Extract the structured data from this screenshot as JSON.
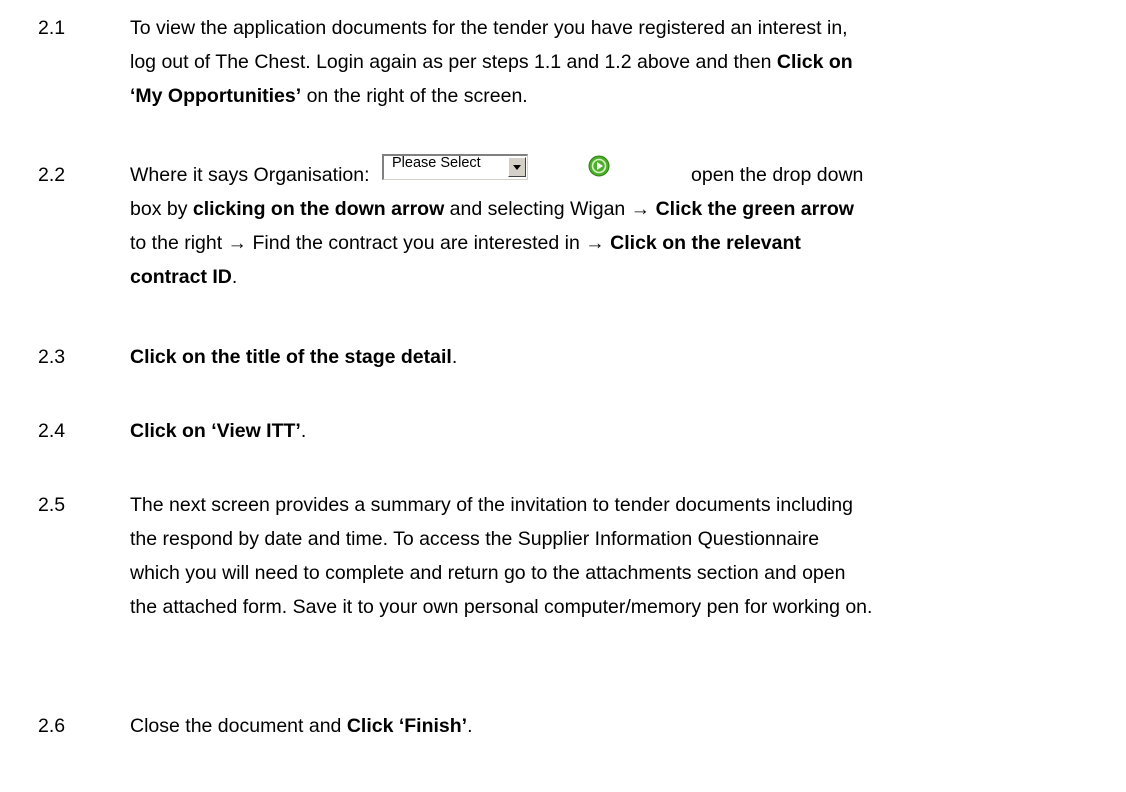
{
  "steps": {
    "s21": {
      "num": "2.1",
      "l1": "To view the application documents for the tender you have registered an interest in,",
      "l2a": "log out of The Chest. Login again as per steps 1.1 and 1.2 above and then ",
      "l2b": "Click on",
      "l3a": "‘My Opportunities’",
      "l3b": " on the right of the screen."
    },
    "s22": {
      "num": "2.2",
      "l1a": "Where it says Organisation:",
      "select_value": "Please Select",
      "l1b": "open the drop down",
      "l2a": "box by ",
      "l2b": "clicking on the down arrow",
      "l2c": " and selecting Wigan → ",
      "l2d": "Click the green arrow",
      "l3a": "to the right → Find the contract you are interested in → ",
      "l3b": "Click on the relevant",
      "l4a": "contract ID",
      "l4b": "."
    },
    "s23": {
      "num": "2.3",
      "bold": "Click on the title of the stage detail",
      "tail": "."
    },
    "s24": {
      "num": "2.4",
      "bold": "Click on ‘View ITT’",
      "tail": "."
    },
    "s25": {
      "num": "2.5",
      "l1": "The next screen provides a summary of the invitation to tender documents including",
      "l2": "the respond by date and time. To access the Supplier Information Questionnaire",
      "l3": "which you will need to complete and return go to the attachments section and open",
      "l4": "the attached form. Save it to your own personal computer/memory pen for working on."
    },
    "s26": {
      "num": "2.6",
      "a": "Close the document and ",
      "bold": "Click ‘Finish’",
      "tail": "."
    }
  },
  "icons": {
    "select_arrow": "chevron-down-icon",
    "go_button": "green-arrow-go-icon"
  },
  "colors": {
    "go_green": "#4caf2a"
  }
}
